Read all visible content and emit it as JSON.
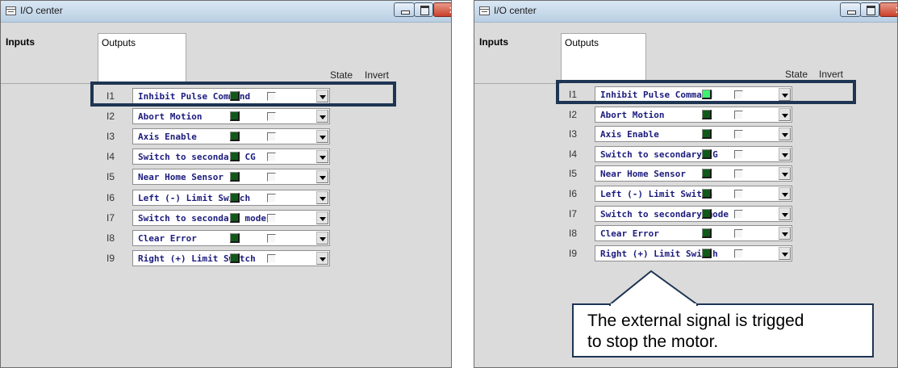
{
  "window_title": "I/O center",
  "tabs": [
    {
      "label": "Inputs"
    },
    {
      "label": "Outputs"
    }
  ],
  "columns": {
    "state": "State",
    "invert": "Invert"
  },
  "inputs": [
    {
      "id": "I1",
      "function": "Inhibit Pulse Command"
    },
    {
      "id": "I2",
      "function": "Abort Motion"
    },
    {
      "id": "I3",
      "function": "Axis Enable"
    },
    {
      "id": "I4",
      "function": "Switch to secondary CG"
    },
    {
      "id": "I5",
      "function": "Near Home Sensor"
    },
    {
      "id": "I6",
      "function": "Left (-) Limit Switch"
    },
    {
      "id": "I7",
      "function": "Switch to secondary mode"
    },
    {
      "id": "I8",
      "function": "Clear Error"
    },
    {
      "id": "I9",
      "function": "Right (+) Limit Switch"
    }
  ],
  "state_before": [
    "off",
    "off",
    "off",
    "off",
    "off",
    "off",
    "off",
    "off",
    "off"
  ],
  "state_after": [
    "on",
    "off",
    "off",
    "off",
    "off",
    "off",
    "off",
    "off",
    "off"
  ],
  "invert_checked": [
    false,
    false,
    false,
    false,
    false,
    false,
    false,
    false,
    false
  ],
  "colors": {
    "led_off": "#0f5a18",
    "led_on": "#3cf070",
    "highlight_border": "#1e3553",
    "combo_text": "#1c1c7e"
  },
  "icons": {
    "app": "window-icon",
    "minimize": "minimize-icon",
    "maximize": "maximize-icon",
    "close": "close-icon",
    "dropdown": "dropdown-arrow-icon"
  },
  "callout": {
    "text_line1": "The external signal is trigged",
    "text_line2": "to stop the motor."
  }
}
